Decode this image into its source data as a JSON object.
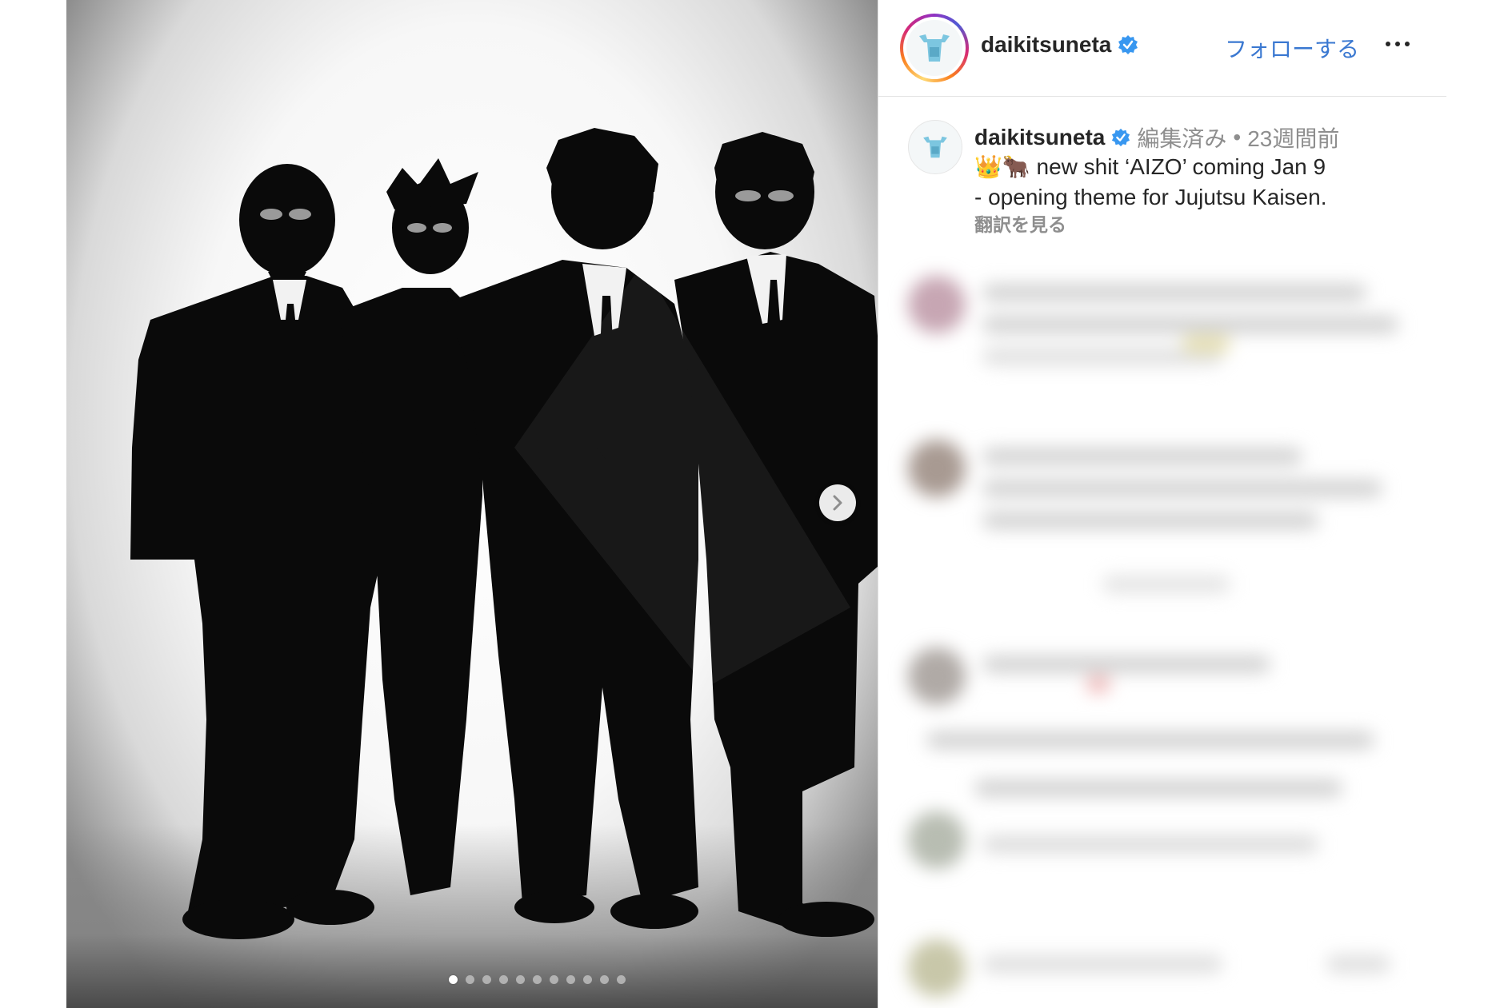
{
  "post": {
    "carousel": {
      "total": 11,
      "active_index": 0
    },
    "colors": {
      "background_white": "#ffffff",
      "suit_black": "#0a0a0a"
    }
  },
  "header": {
    "username": "daikitsuneta",
    "follow_label": "フォローする"
  },
  "caption": {
    "username": "daikitsuneta",
    "edited_label": "編集済み",
    "separator": "•",
    "time_ago": "23週間前",
    "emoji": "👑🐂",
    "line1": "new shit ‘AIZO’ coming Jan 9",
    "line2": "-  opening theme for Jujutsu Kaisen.",
    "translate_label": "翻訳を見る"
  },
  "colors": {
    "link_blue": "#3a78d1",
    "verified_blue": "#3897f0",
    "muted_gray": "#8e8e8e",
    "divider": "#e3e3e3"
  }
}
